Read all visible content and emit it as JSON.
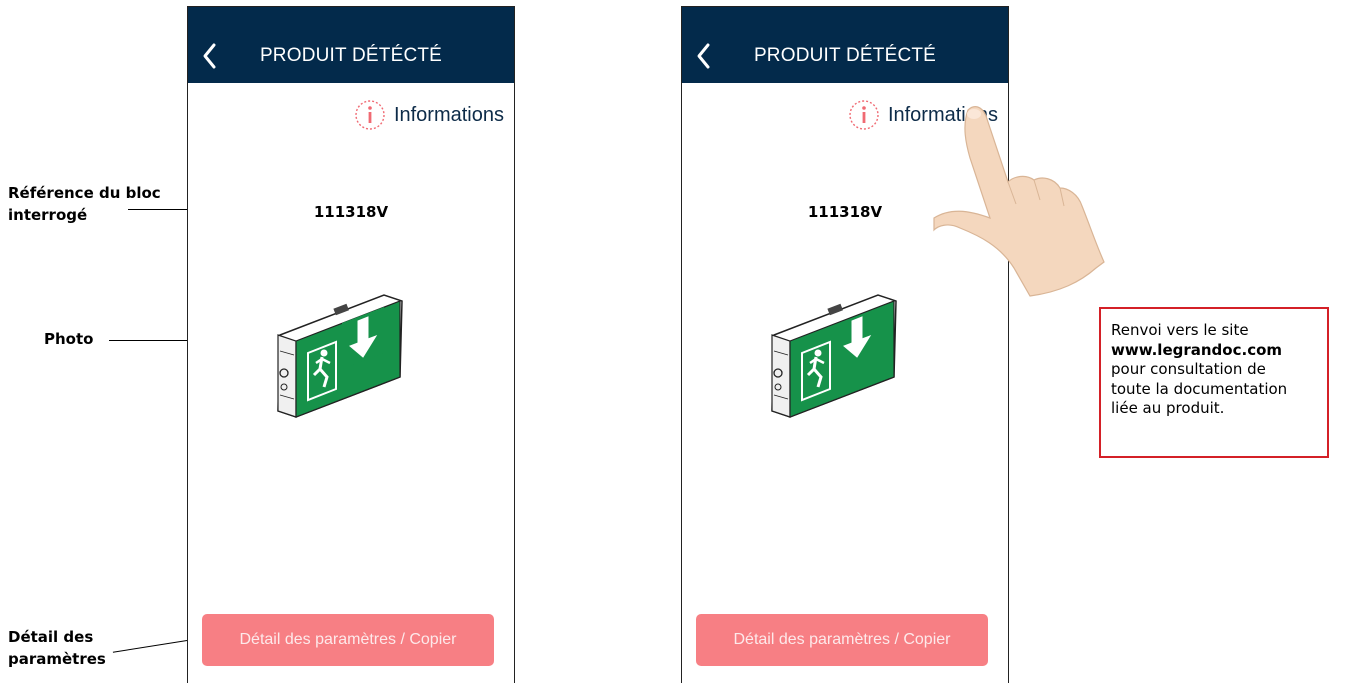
{
  "annotations": {
    "reference_label_line1": "Référence du bloc",
    "reference_label_line2": "interrogé",
    "photo_label": "Photo",
    "detail_label_line1": "Détail des",
    "detail_label_line2": "paramètres"
  },
  "screen": {
    "title": "PRODUIT DÉTÉCTÉ",
    "info_label": "Informations",
    "reference": "111318V",
    "detail_button_label": "Détail des paramètres / Copier"
  },
  "callout": {
    "line1": "Renvoi vers le site",
    "url": "www.legrandoc.com",
    "line3": "pour consultation de",
    "line4": "toute la documentation",
    "line5": "liée au produit."
  },
  "colors": {
    "header_bg": "#032a4b",
    "button_bg": "#f77f84",
    "info_icon": "#f06a73",
    "callout_border": "#d42027",
    "sign_green": "#16924a"
  },
  "icons": {
    "back": "chevron-left-icon",
    "info": "info-circle-icon",
    "pointer": "pointing-hand"
  }
}
